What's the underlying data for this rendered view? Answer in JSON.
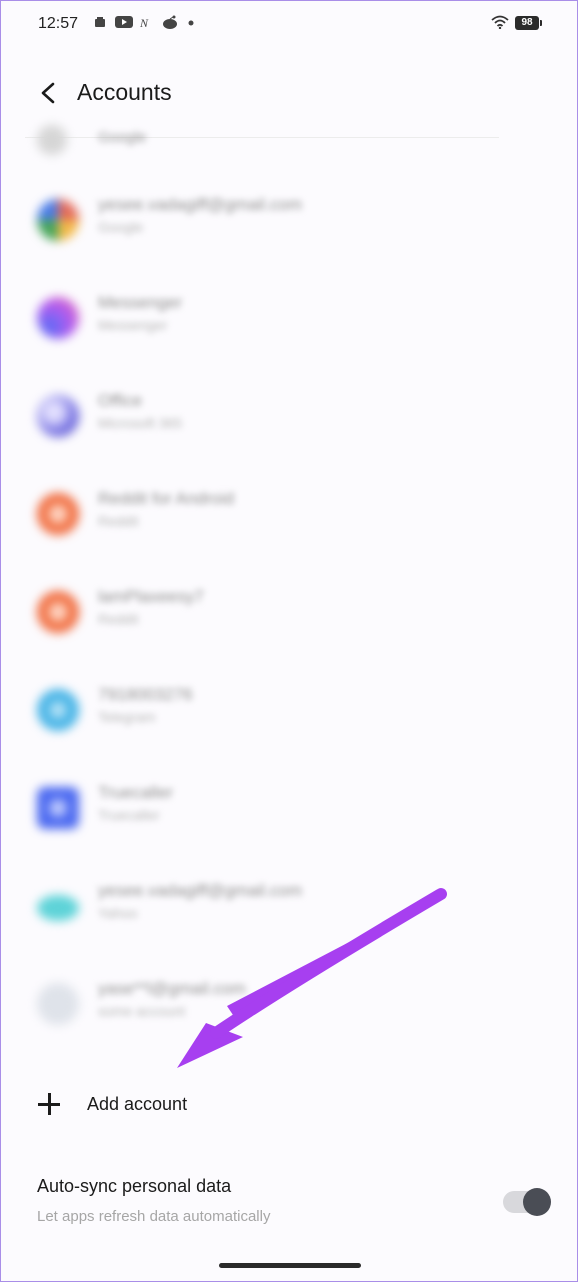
{
  "status_bar": {
    "time": "12:57",
    "battery": "98",
    "icons": [
      "notification-icon",
      "youtube-icon",
      "nova-icon",
      "reddit-icon",
      "dot-icon",
      "wifi-icon",
      "battery-icon"
    ]
  },
  "header": {
    "title": "Accounts"
  },
  "accounts": [
    {
      "name": "Google",
      "sub": "",
      "color": "#d6d6d6"
    },
    {
      "name": "yesee.vadagiff@gmail.com",
      "sub": "Google",
      "color": "#e36b5a"
    },
    {
      "name": "Messenger",
      "sub": "Messenger",
      "color": "#b05cf0"
    },
    {
      "name": "Office",
      "sub": "Microsoft 365",
      "color": "#6f6ae0"
    },
    {
      "name": "Reddit for Android",
      "sub": "Reddit",
      "color": "#f06a3c"
    },
    {
      "name": "lamPlaxeesy7",
      "sub": "Reddit",
      "color": "#f06a3c"
    },
    {
      "name": "7918003276",
      "sub": "Telegram",
      "color": "#45b3e6"
    },
    {
      "name": "Truecaller",
      "sub": "Truecaller",
      "color": "#4a68f0"
    },
    {
      "name": "yesee.vadagiff@gmail.com",
      "sub": "Yahoo",
      "color": "#5ed3d8"
    },
    {
      "name": "yase**l@gmail.com",
      "sub": "some account",
      "color": "#dfe3ea"
    }
  ],
  "add_account": {
    "label": "Add account"
  },
  "auto_sync": {
    "title": "Auto-sync personal data",
    "subtitle": "Let apps refresh data automatically",
    "enabled": true
  },
  "colors": {
    "arrow": "#a73ff0",
    "frame_border": "#a98ee8"
  }
}
